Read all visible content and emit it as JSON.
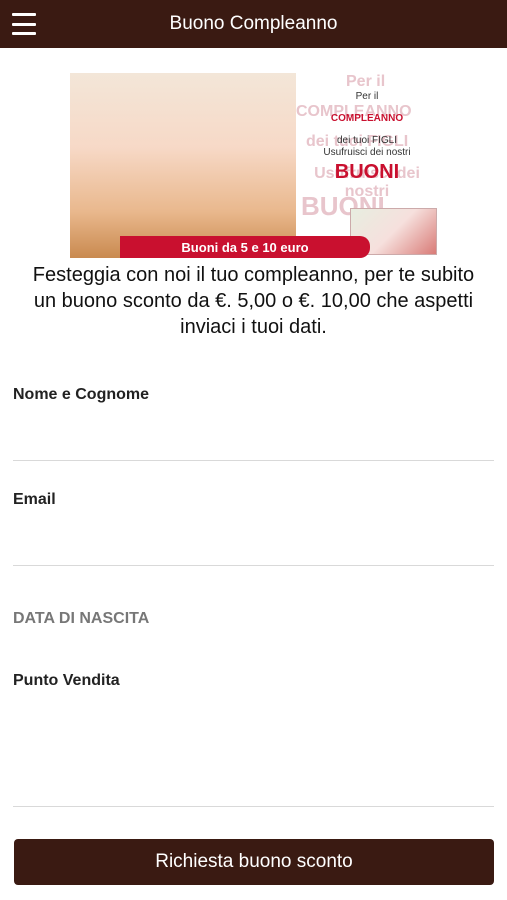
{
  "header": {
    "title": "Buono Compleanno",
    "menu_icon": "hamburger-menu-icon"
  },
  "banner": {
    "faint_text": [
      "Per il",
      "COMPLEANNO",
      "dei tuoi FIGLI",
      "Usufruisci dei nostri",
      "BUONI"
    ],
    "line1": "Per il",
    "line2": "COMPLEANNO",
    "line3": "dei tuoi FIGLI",
    "line4": "Usufruisci dei nostri",
    "line5": "BUONI",
    "ribbon": "Buoni da 5 e 10 euro"
  },
  "intro": "Festeggia con noi il tuo compleanno, per te subito un buono sconto da €. 5,00 o €. 10,00 che aspetti inviaci i tuoi dati.",
  "form": {
    "name_label": "Nome e Cognome",
    "email_label": "Email",
    "birthdate_label": "DATA DI NASCITA",
    "store_label": "Punto Vendita",
    "submit_label": "Richiesta buono sconto"
  },
  "colors": {
    "header_bg": "#3a1a12",
    "button_bg": "#3a1a12",
    "banner_red": "#c9102f"
  }
}
